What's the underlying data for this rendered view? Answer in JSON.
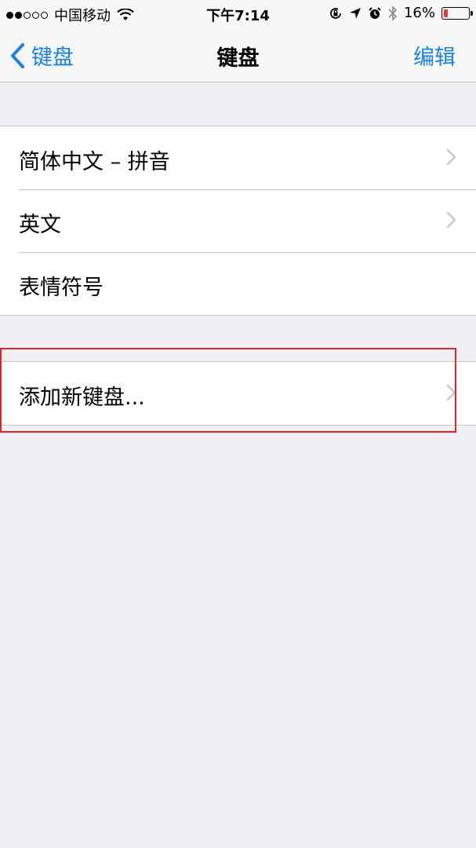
{
  "status_bar": {
    "carrier": "中国移动",
    "time": "下午7:14",
    "battery_percent": "16%",
    "battery_level": 0.16,
    "battery_color": "#e53935"
  },
  "nav": {
    "back_label": "键盘",
    "title": "键盘",
    "edit_label": "编辑",
    "accent_color": "#1a82e6"
  },
  "keyboards": [
    {
      "label": "简体中文 – 拼音",
      "disclosure": true
    },
    {
      "label": "英文",
      "disclosure": true
    },
    {
      "label": "表情符号",
      "disclosure": false
    }
  ],
  "add_keyboard": {
    "label": "添加新键盘...",
    "disclosure": true,
    "highlighted": true,
    "highlight_color": "#e0242b"
  }
}
